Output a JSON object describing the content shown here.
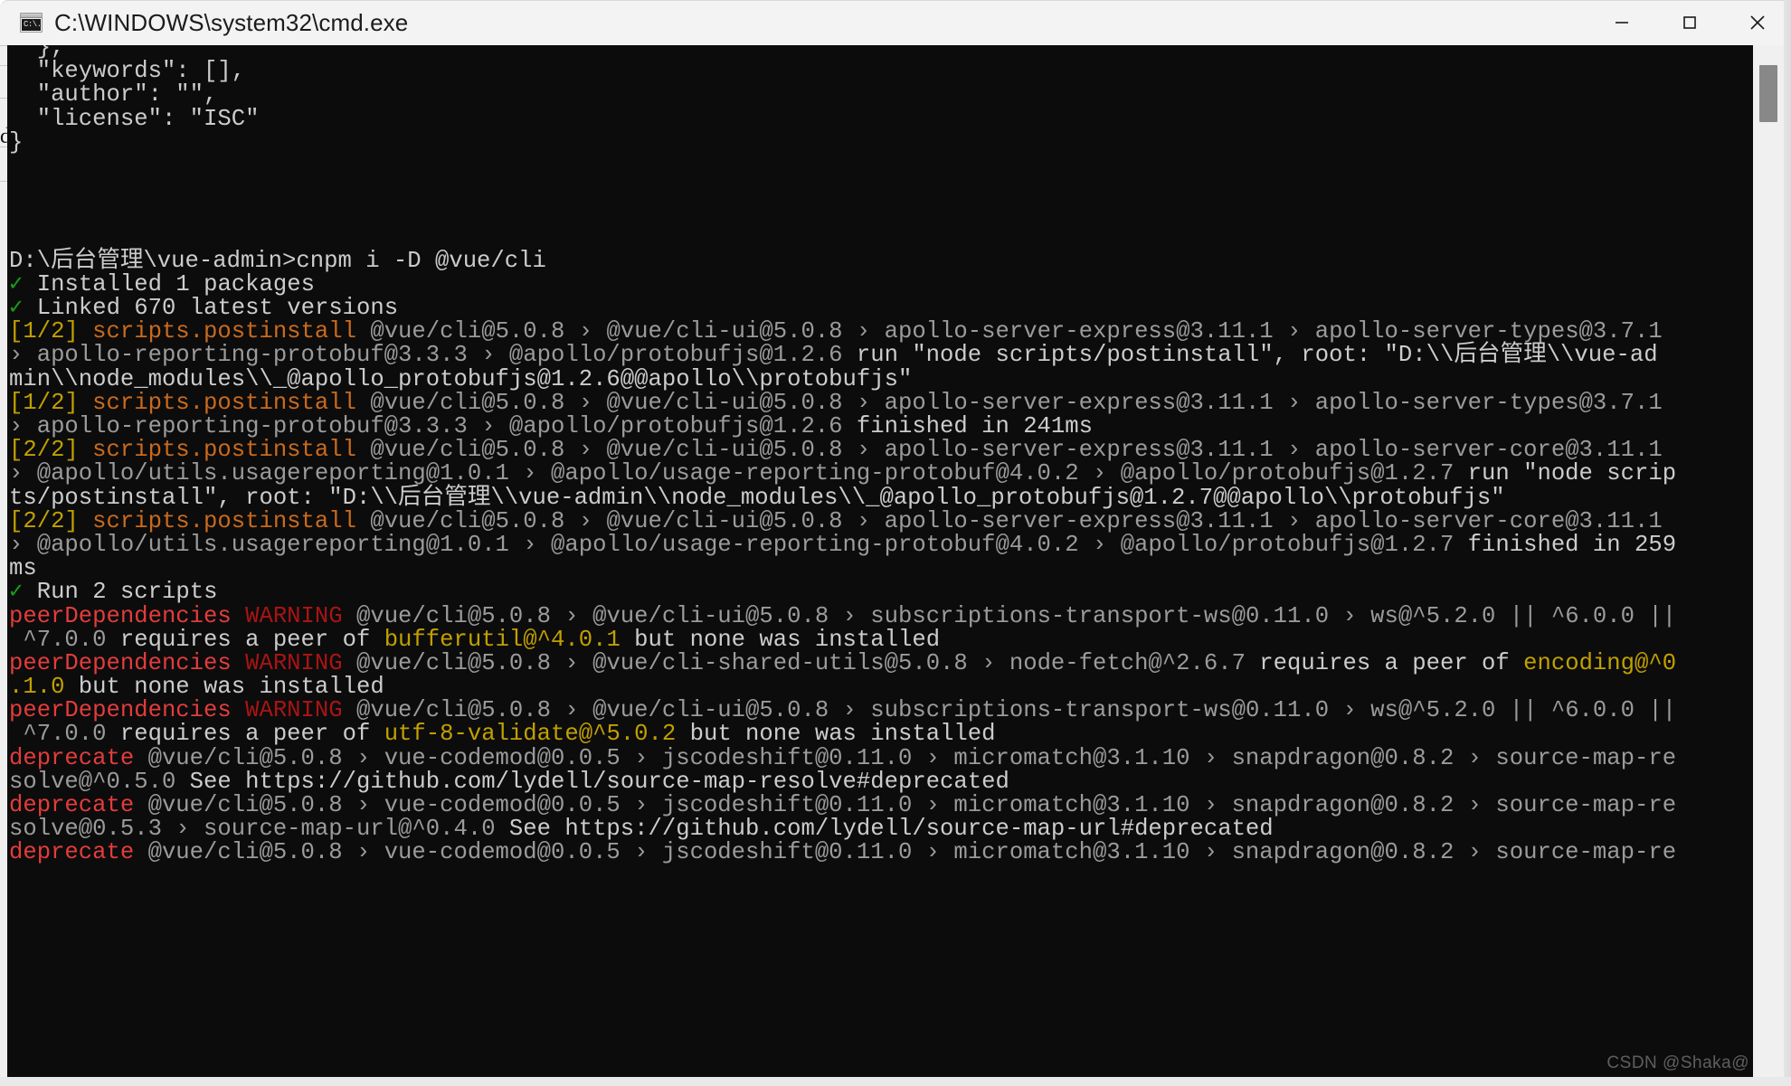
{
  "window": {
    "title": "C:\\WINDOWS\\system32\\cmd.exe",
    "icon_label": "cmd-icon",
    "icon_text": "C:\\.",
    "controls": {
      "minimize": "minimize",
      "maximize": "maximize",
      "close": "close"
    }
  },
  "watermark": "CSDN @Shaka@",
  "colors": {
    "terminal_bg": "#0c0c0c",
    "default_fg": "#cccccc",
    "dim_fg": "#9b9b9b",
    "green": "#16a016",
    "yellow": "#c1a000",
    "orange": "#c96a1d",
    "red": "#e33c3c",
    "dark_red": "#a81414",
    "chrome_bg": "#f3f3f3",
    "scrollbar_thumb": "#888888"
  },
  "terminal": {
    "lines": [
      {
        "segments": [
          {
            "t": "  },",
            "c": "c-def"
          }
        ]
      },
      {
        "segments": [
          {
            "t": "  \"keywords\": [],",
            "c": "c-def"
          }
        ]
      },
      {
        "segments": [
          {
            "t": "  \"author\": \"\",",
            "c": "c-def"
          }
        ]
      },
      {
        "segments": [
          {
            "t": "  \"license\": \"ISC\"",
            "c": "c-def"
          }
        ]
      },
      {
        "segments": [
          {
            "t": "}",
            "c": "c-def"
          }
        ]
      },
      {
        "segments": [
          {
            "t": "",
            "c": "c-def"
          }
        ]
      },
      {
        "segments": [
          {
            "t": "",
            "c": "c-def"
          }
        ]
      },
      {
        "segments": [
          {
            "t": "",
            "c": "c-def"
          }
        ]
      },
      {
        "segments": [
          {
            "t": "",
            "c": "c-def"
          }
        ]
      },
      {
        "segments": [
          {
            "t": "D:\\后台管理\\vue-admin>cnpm i -D @vue/cli",
            "c": "c-def"
          }
        ]
      },
      {
        "segments": [
          {
            "t": "✓",
            "c": "c-green"
          },
          {
            "t": " Installed 1 packages",
            "c": "c-def"
          }
        ]
      },
      {
        "segments": [
          {
            "t": "✓",
            "c": "c-green"
          },
          {
            "t": " Linked 670 latest versions",
            "c": "c-def"
          }
        ]
      },
      {
        "segments": [
          {
            "t": "[1/2]",
            "c": "c-yellow"
          },
          {
            "t": " ",
            "c": "c-def"
          },
          {
            "t": "scripts.postinstall",
            "c": "c-orange"
          },
          {
            "t": " @vue/cli@5.0.8 › @vue/cli-ui@5.0.8 › apollo-server-express@3.11.1 › apollo-server-types@3.7.1",
            "c": "c-dim"
          }
        ]
      },
      {
        "segments": [
          {
            "t": "› apollo-reporting-protobuf@3.3.3 › @apollo/protobufjs@1.2.6",
            "c": "c-dim"
          },
          {
            "t": " run \"node scripts/postinstall\", root: \"D:\\\\后台管理\\\\vue-ad",
            "c": "c-def"
          }
        ]
      },
      {
        "segments": [
          {
            "t": "min\\\\node_modules\\\\_@apollo_protobufjs@1.2.6@@apollo\\\\protobufjs\"",
            "c": "c-def"
          }
        ]
      },
      {
        "segments": [
          {
            "t": "[1/2]",
            "c": "c-yellow"
          },
          {
            "t": " ",
            "c": "c-def"
          },
          {
            "t": "scripts.postinstall",
            "c": "c-orange"
          },
          {
            "t": " @vue/cli@5.0.8 › @vue/cli-ui@5.0.8 › apollo-server-express@3.11.1 › apollo-server-types@3.7.1",
            "c": "c-dim"
          }
        ]
      },
      {
        "segments": [
          {
            "t": "› apollo-reporting-protobuf@3.3.3 › @apollo/protobufjs@1.2.6",
            "c": "c-dim"
          },
          {
            "t": " finished in 241ms",
            "c": "c-def"
          }
        ]
      },
      {
        "segments": [
          {
            "t": "[2/2]",
            "c": "c-yellow"
          },
          {
            "t": " ",
            "c": "c-def"
          },
          {
            "t": "scripts.postinstall",
            "c": "c-orange"
          },
          {
            "t": " @vue/cli@5.0.8 › @vue/cli-ui@5.0.8 › apollo-server-express@3.11.1 › apollo-server-core@3.11.1",
            "c": "c-dim"
          }
        ]
      },
      {
        "segments": [
          {
            "t": "› @apollo/utils.usagereporting@1.0.1 › @apollo/usage-reporting-protobuf@4.0.2 › @apollo/protobufjs@1.2.7",
            "c": "c-dim"
          },
          {
            "t": " run \"node scrip",
            "c": "c-def"
          }
        ]
      },
      {
        "segments": [
          {
            "t": "ts/postinstall\", root: \"D:\\\\后台管理\\\\vue-admin\\\\node_modules\\\\_@apollo_protobufjs@1.2.7@@apollo\\\\protobufjs\"",
            "c": "c-def"
          }
        ]
      },
      {
        "segments": [
          {
            "t": "[2/2]",
            "c": "c-yellow"
          },
          {
            "t": " ",
            "c": "c-def"
          },
          {
            "t": "scripts.postinstall",
            "c": "c-orange"
          },
          {
            "t": " @vue/cli@5.0.8 › @vue/cli-ui@5.0.8 › apollo-server-express@3.11.1 › apollo-server-core@3.11.1",
            "c": "c-dim"
          }
        ]
      },
      {
        "segments": [
          {
            "t": "› @apollo/utils.usagereporting@1.0.1 › @apollo/usage-reporting-protobuf@4.0.2 › @apollo/protobufjs@1.2.7",
            "c": "c-dim"
          },
          {
            "t": " finished in 259",
            "c": "c-def"
          }
        ]
      },
      {
        "segments": [
          {
            "t": "ms",
            "c": "c-def"
          }
        ]
      },
      {
        "segments": [
          {
            "t": "✓",
            "c": "c-green"
          },
          {
            "t": " Run 2 scripts",
            "c": "c-def"
          }
        ]
      },
      {
        "segments": [
          {
            "t": "peerDependencies",
            "c": "c-red"
          },
          {
            "t": " ",
            "c": "c-def"
          },
          {
            "t": "WARNING",
            "c": "c-darkred"
          },
          {
            "t": " @vue/cli@5.0.8 › @vue/cli-ui@5.0.8 › subscriptions-transport-ws@0.11.0 › ws@^5.2.0 || ^6.0.0 ||",
            "c": "c-dim"
          }
        ]
      },
      {
        "segments": [
          {
            "t": " ^7.0.0",
            "c": "c-dim"
          },
          {
            "t": " requires a peer of ",
            "c": "c-def"
          },
          {
            "t": "bufferutil@^4.0.1",
            "c": "c-yellow"
          },
          {
            "t": " but none was installed",
            "c": "c-def"
          }
        ]
      },
      {
        "segments": [
          {
            "t": "peerDependencies",
            "c": "c-red"
          },
          {
            "t": " ",
            "c": "c-def"
          },
          {
            "t": "WARNING",
            "c": "c-darkred"
          },
          {
            "t": " @vue/cli@5.0.8 › @vue/cli-shared-utils@5.0.8 › node-fetch@^2.6.7",
            "c": "c-dim"
          },
          {
            "t": " requires a peer of ",
            "c": "c-def"
          },
          {
            "t": "encoding@^0",
            "c": "c-yellow"
          }
        ]
      },
      {
        "segments": [
          {
            "t": ".1.0",
            "c": "c-yellow"
          },
          {
            "t": " but none was installed",
            "c": "c-def"
          }
        ]
      },
      {
        "segments": [
          {
            "t": "peerDependencies",
            "c": "c-red"
          },
          {
            "t": " ",
            "c": "c-def"
          },
          {
            "t": "WARNING",
            "c": "c-darkred"
          },
          {
            "t": " @vue/cli@5.0.8 › @vue/cli-ui@5.0.8 › subscriptions-transport-ws@0.11.0 › ws@^5.2.0 || ^6.0.0 ||",
            "c": "c-dim"
          }
        ]
      },
      {
        "segments": [
          {
            "t": " ^7.0.0",
            "c": "c-dim"
          },
          {
            "t": " requires a peer of ",
            "c": "c-def"
          },
          {
            "t": "utf-8-validate@^5.0.2",
            "c": "c-yellow"
          },
          {
            "t": " but none was installed",
            "c": "c-def"
          }
        ]
      },
      {
        "segments": [
          {
            "t": "deprecate",
            "c": "c-red"
          },
          {
            "t": " @vue/cli@5.0.8 › vue-codemod@0.0.5 › jscodeshift@0.11.0 › micromatch@3.1.10 › snapdragon@0.8.2 › source-map-re",
            "c": "c-dim"
          }
        ]
      },
      {
        "segments": [
          {
            "t": "solve@^0.5.0",
            "c": "c-dim"
          },
          {
            "t": " See https://github.com/lydell/source-map-resolve#deprecated",
            "c": "c-def"
          }
        ]
      },
      {
        "segments": [
          {
            "t": "deprecate",
            "c": "c-red"
          },
          {
            "t": " @vue/cli@5.0.8 › vue-codemod@0.0.5 › jscodeshift@0.11.0 › micromatch@3.1.10 › snapdragon@0.8.2 › source-map-re",
            "c": "c-dim"
          }
        ]
      },
      {
        "segments": [
          {
            "t": "solve@0.5.3 › source-map-url@^0.4.0",
            "c": "c-dim"
          },
          {
            "t": " See https://github.com/lydell/source-map-url#deprecated",
            "c": "c-def"
          }
        ]
      },
      {
        "segments": [
          {
            "t": "deprecate",
            "c": "c-red"
          },
          {
            "t": " @vue/cli@5.0.8 › vue-codemod@0.0.5 › jscodeshift@0.11.0 › micromatch@3.1.10 › snapdragon@0.8.2 › source-map-re",
            "c": "c-dim"
          }
        ]
      }
    ]
  },
  "background_hint": {
    "glyph": "dr"
  }
}
